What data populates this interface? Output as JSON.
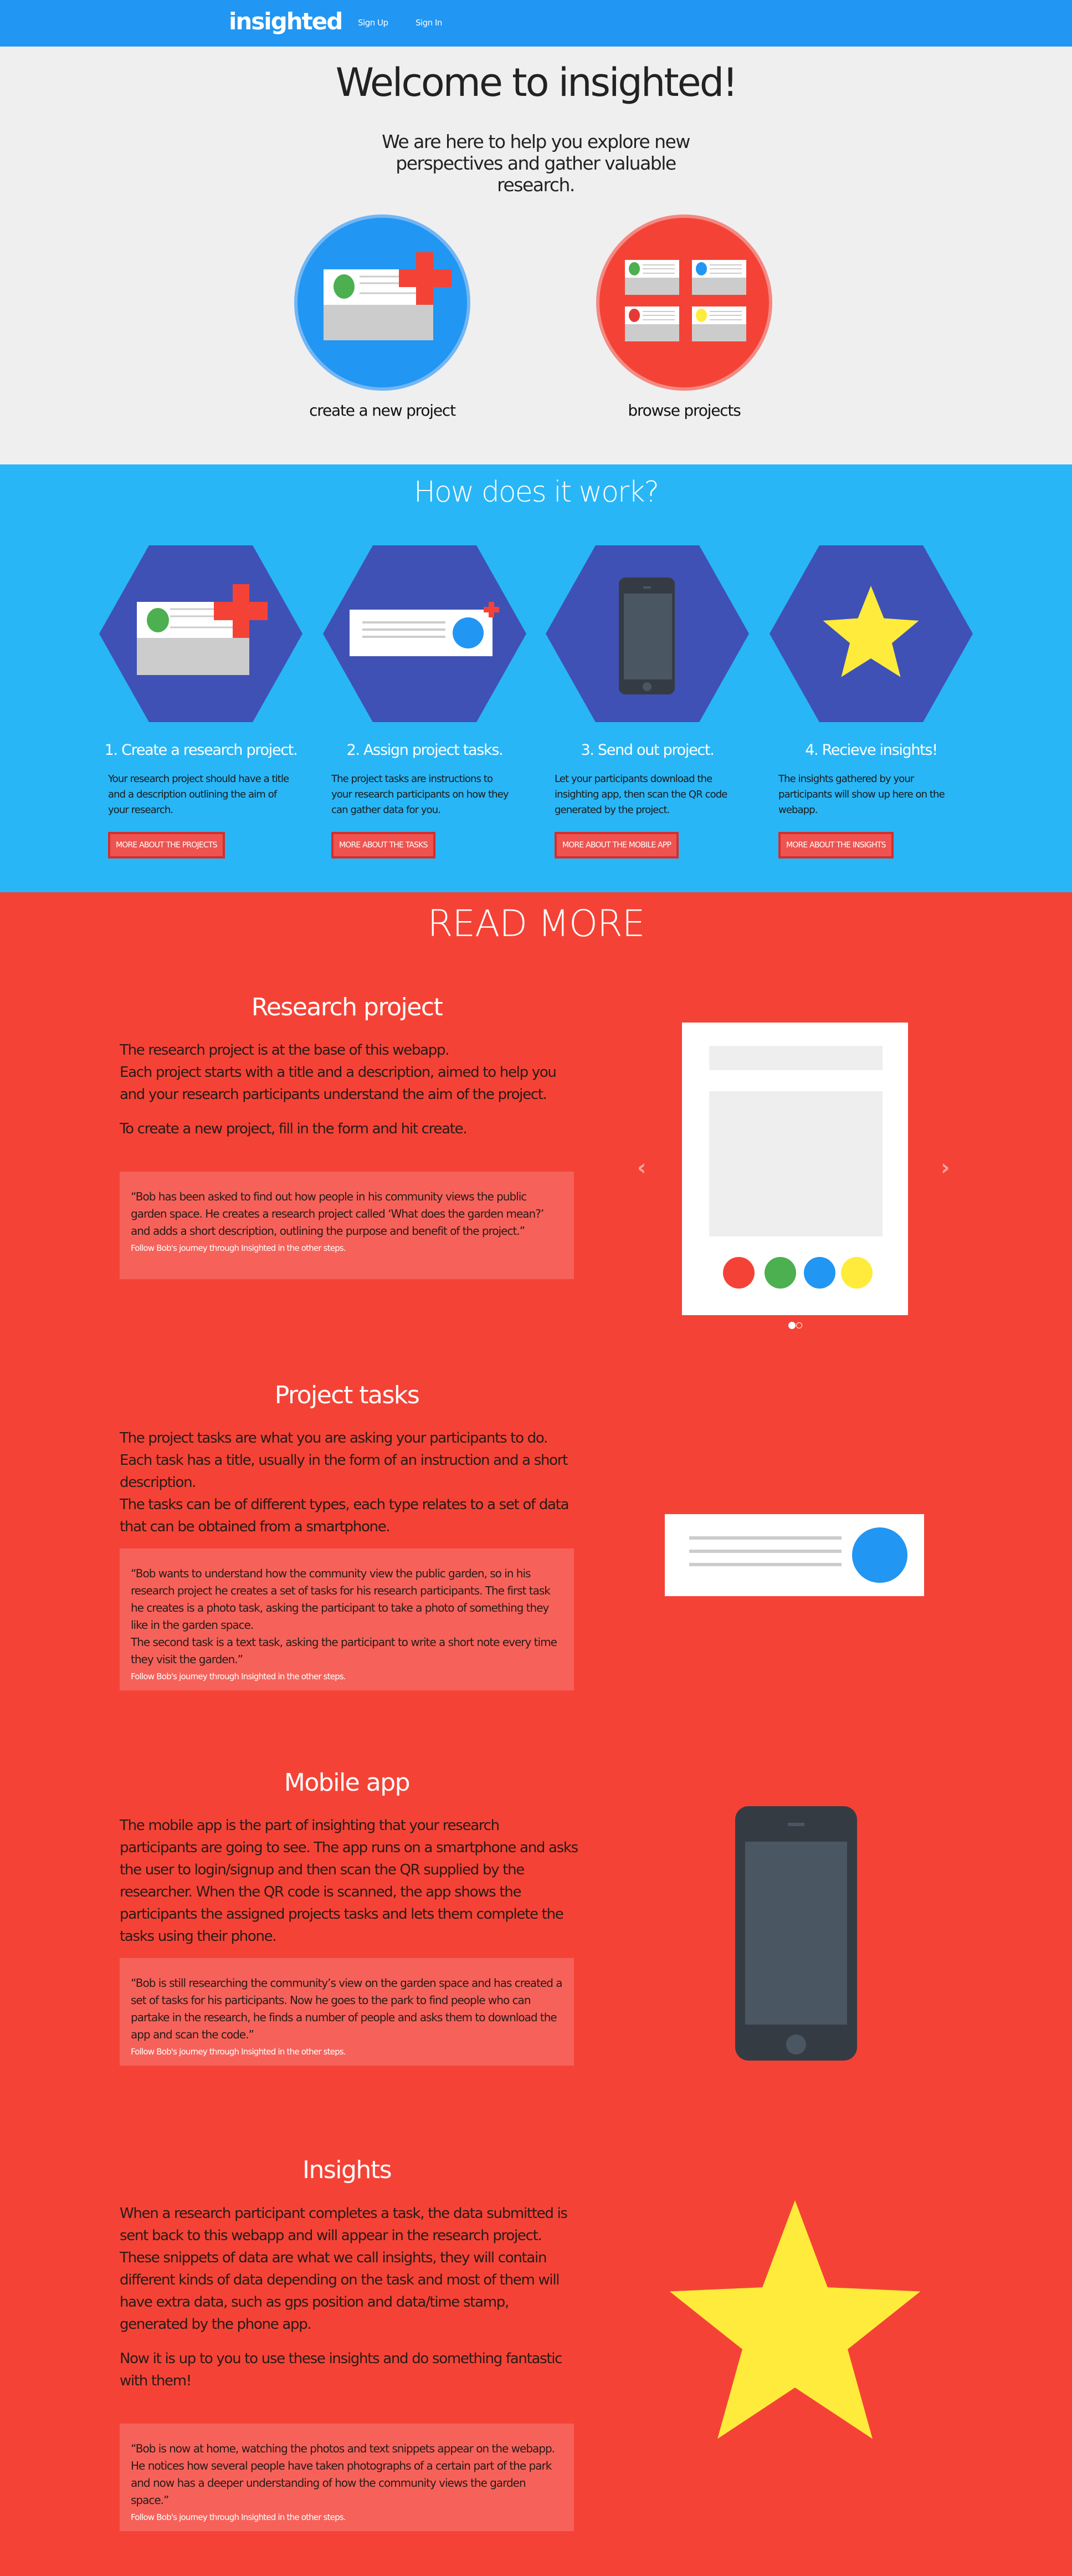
{
  "nav": {
    "logo": "insighted",
    "sign_up": "Sign Up",
    "sign_in": "Sign In"
  },
  "hero": {
    "title": "Welcome to insighted!",
    "subtitle": "We are here to help you explore new perspectives and gather valuable research.",
    "create_label": "create a new project",
    "browse_label": "browse projects"
  },
  "how": {
    "title": "How does it work?",
    "steps": [
      {
        "title": "1. Create a research project.",
        "desc": "Your research project should have a title and a description outlining the aim of your research.",
        "button": "MORE ABOUT THE PROJECTS"
      },
      {
        "title": "2. Assign project tasks.",
        "desc": "The project tasks are instructions to your research participants on how they can gather data for you.",
        "button": "MORE ABOUT THE TASKS"
      },
      {
        "title": "3. Send out project.",
        "desc": "Let your participants download the insighting app, then scan the QR code generated by the project.",
        "button": "MORE ABOUT THE MOBILE APP"
      },
      {
        "title": "4. Recieve insights!",
        "desc": "The insights gathered by your participants will show up here on the webapp.",
        "button": "MORE ABOUT THE INSIGHTS"
      }
    ]
  },
  "readmore": {
    "title": "READ MORE",
    "note": "Follow Bob's journey through Insighted in the other steps.",
    "sections": [
      {
        "heading": "Research project",
        "paragraphs": [
          "The research project is at the base of this webapp.\nEach project starts with a title and a description, aimed to help you and your research participants understand the aim of the project.",
          "To create a new project, fill in the form and hit create."
        ],
        "quote": "“Bob has been asked to find out how people in his community views the public garden space. He creates a research project called ‘What does the garden mean?’ and adds a short description, outlining the purpose and benefit of the project.”"
      },
      {
        "heading": "Project tasks",
        "paragraphs": [
          "The project tasks are what you are asking your participants to do.\nEach task has a title, usually in the form of an instruction and a short description.\nThe tasks can be of different types, each type relates to a set of data that can be obtained from a smartphone."
        ],
        "quote": "“Bob wants to understand how the community view the public garden, so in his research project he creates a set of tasks for his research participants. The first task he creates is a photo task, asking the participant to take a photo of something they like in the garden space.\nThe second task is a text task, asking the participant to write a short note every time they visit the garden.”"
      },
      {
        "heading": "Mobile app",
        "paragraphs": [
          "The mobile app is the part of insighting that your research participants are going to see. The app runs on a smartphone and asks the user to login/signup and then scan the QR supplied by the researcher. When the QR code is scanned, the app shows the participants the assigned projects tasks and lets them complete the tasks using their phone."
        ],
        "quote": "“Bob is still researching the community’s view on the garden space and has created a set of tasks for his participants. Now he goes to the park to find people who can partake in the research, he finds a number of people and asks them to download the app and scan the code.”"
      },
      {
        "heading": "Insights",
        "paragraphs": [
          "When a research participant completes a task, the data submitted is sent back to this webapp and will appear in the research project.\nThese snippets of data are what we call insights, they will contain different kinds of data depending on the task and most of them will have extra data, such as gps position and data/time stamp, generated by the phone app.",
          "Now it is up to you to use these insights and do something fantastic with them!"
        ],
        "quote": "“Bob is now at home, watching the photos and text snippets appear on the webapp. He notices how several people have taken photographs of a certain part of the park and now has a deeper understanding of how the community views the garden space.”"
      }
    ],
    "carousel": {
      "prev": "‹",
      "next": "›",
      "slides": 2,
      "active_slide": 1
    }
  },
  "colors": {
    "nav": "#2196f3",
    "how": "#29b6f6",
    "hex": "#3f51b5",
    "red": "#f44336",
    "green": "#4caf50",
    "blue": "#2196f3",
    "yellow": "#ffeb3b"
  }
}
